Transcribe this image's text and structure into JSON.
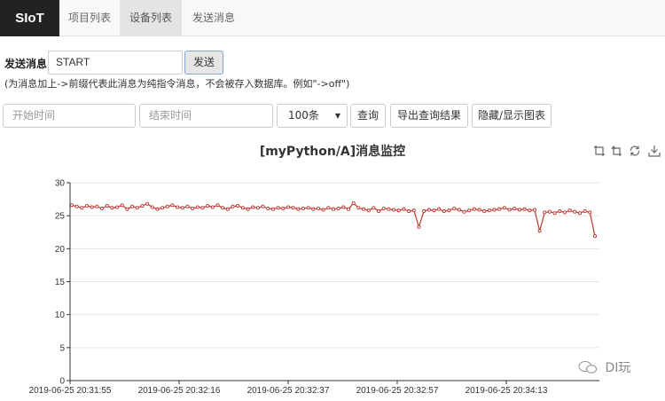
{
  "nav": {
    "brand": "SIoT",
    "tabs": [
      {
        "label": "项目列表",
        "active": false
      },
      {
        "label": "设备列表",
        "active": true
      },
      {
        "label": "发送消息",
        "active": false
      }
    ]
  },
  "send": {
    "label": "发送消息",
    "input_value": "START",
    "button_label": "发送",
    "hint": "(为消息加上->前缀代表此消息为纯指令消息，不会被存入数据库。例如\"->off\")"
  },
  "filters": {
    "start_placeholder": "开始时间",
    "end_placeholder": "结束时间",
    "count_selected": "100条",
    "query_label": "查询",
    "export_label": "导出查询结果",
    "toggle_chart_label": "隐藏/显示图表"
  },
  "toolbox": {
    "icons": [
      "zoom-icon",
      "zoom-reset-icon",
      "restore-icon",
      "download-icon"
    ]
  },
  "watermark": {
    "text": "DI玩"
  },
  "colors": {
    "line": "#c23531",
    "brand_bg": "#222222",
    "active_tab_bg": "#e4e4e4"
  },
  "chart_data": {
    "type": "line",
    "title": "[myPython/A]消息监控",
    "xlabel": "",
    "ylabel": "",
    "ylim": [
      0,
      30
    ],
    "yticks": [
      0,
      5,
      10,
      15,
      20,
      25,
      30
    ],
    "grid": true,
    "x_tick_labels": [
      "2019-06-25 20:31:55",
      "2019-06-25 20:32:16",
      "2019-06-25 20:32:37",
      "2019-06-25 20:32:57",
      "2019-06-25 20:34:13"
    ],
    "series": [
      {
        "values": [
          26.6,
          26.4,
          26.2,
          26.5,
          26.3,
          26.4,
          26.1,
          26.5,
          26.2,
          26.3,
          26.6,
          26.0,
          26.4,
          26.2,
          26.5,
          26.8,
          26.3,
          26.0,
          26.2,
          26.4,
          26.6,
          26.3,
          26.2,
          26.4,
          26.1,
          26.3,
          26.2,
          26.5,
          26.3,
          26.6,
          26.2,
          26.0,
          26.4,
          26.5,
          26.2,
          26.0,
          26.3,
          26.2,
          26.4,
          26.1,
          26.0,
          26.2,
          26.1,
          26.3,
          26.2,
          26.0,
          26.1,
          26.2,
          26.0,
          26.1,
          25.9,
          26.2,
          26.0,
          26.1,
          26.3,
          26.0,
          26.9,
          26.2,
          26.0,
          25.8,
          26.2,
          25.7,
          26.1,
          26.0,
          25.9,
          25.8,
          26.0,
          25.7,
          25.8,
          23.3,
          25.7,
          25.9,
          25.8,
          26.0,
          25.7,
          25.8,
          26.1,
          25.9,
          25.6,
          25.8,
          26.0,
          25.9,
          25.7,
          25.8,
          25.9,
          26.0,
          26.2,
          25.9,
          26.1,
          25.9,
          26.0,
          25.8,
          25.9,
          22.7,
          25.5,
          25.6,
          25.4,
          25.7,
          25.5,
          25.8,
          25.6,
          25.4,
          25.7,
          25.5,
          21.9
        ]
      }
    ]
  }
}
